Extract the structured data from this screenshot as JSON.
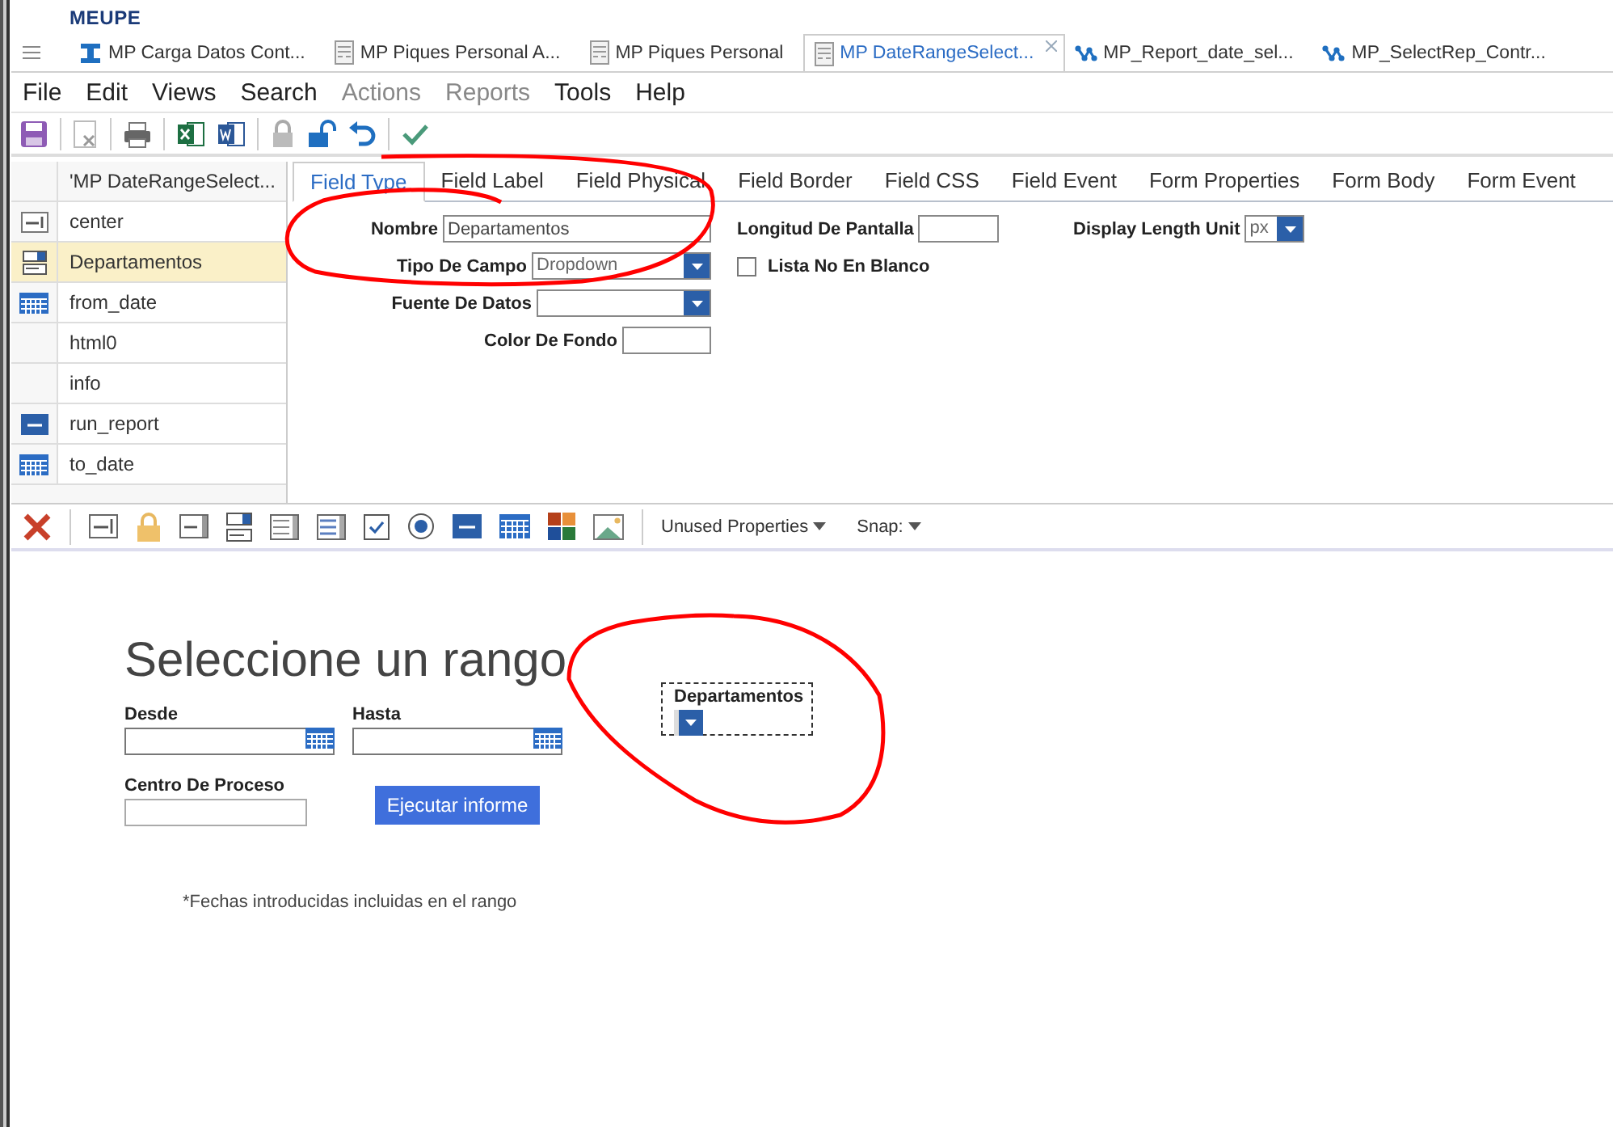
{
  "logo": {
    "text": "MEUPE"
  },
  "tabs": [
    {
      "label": "MP Carga Datos Cont...",
      "kind": "beam",
      "selected": false
    },
    {
      "label": "MP Piques Personal A...",
      "kind": "form",
      "selected": false
    },
    {
      "label": "MP Piques Personal",
      "kind": "form",
      "selected": false
    },
    {
      "label": "MP DateRangeSelect...",
      "kind": "form",
      "selected": true
    },
    {
      "label": "MP_Report_date_sel...",
      "kind": "flow",
      "selected": false
    },
    {
      "label": "MP_SelectRep_Contr...",
      "kind": "flow",
      "selected": false
    }
  ],
  "menu": [
    {
      "label": "File",
      "disabled": false
    },
    {
      "label": "Edit",
      "disabled": false
    },
    {
      "label": "Views",
      "disabled": false
    },
    {
      "label": "Search",
      "disabled": false
    },
    {
      "label": "Actions",
      "disabled": true
    },
    {
      "label": "Reports",
      "disabled": true
    },
    {
      "label": "Tools",
      "disabled": false
    },
    {
      "label": "Help",
      "disabled": false
    }
  ],
  "fields_list": {
    "header": "'MP DateRangeSelect...",
    "items": [
      {
        "name": "center",
        "kind": "text",
        "selected": false
      },
      {
        "name": "Departamentos",
        "kind": "dropdown",
        "selected": true
      },
      {
        "name": "from_date",
        "kind": "date",
        "selected": false
      },
      {
        "name": "html0",
        "kind": "html",
        "selected": false
      },
      {
        "name": "info",
        "kind": "html",
        "selected": false
      },
      {
        "name": "run_report",
        "kind": "button",
        "selected": false
      },
      {
        "name": "to_date",
        "kind": "date",
        "selected": false
      }
    ]
  },
  "property_tabs": [
    {
      "label": "Field Type",
      "selected": true
    },
    {
      "label": "Field Label",
      "selected": false
    },
    {
      "label": "Field Physical",
      "selected": false
    },
    {
      "label": "Field Border",
      "selected": false
    },
    {
      "label": "Field CSS",
      "selected": false
    },
    {
      "label": "Field Event",
      "selected": false
    },
    {
      "label": "Form Properties",
      "selected": false
    },
    {
      "label": "Form Body",
      "selected": false
    },
    {
      "label": "Form Event",
      "selected": false
    }
  ],
  "properties": {
    "nombre": {
      "label": "Nombre",
      "value": "Departamentos"
    },
    "longitud": {
      "label": "Longitud De Pantalla"
    },
    "display_length_unit": {
      "label": "Display Length Unit",
      "value": "px"
    },
    "tipo_de_campo": {
      "label": "Tipo De Campo",
      "value": "Dropdown"
    },
    "lista_no_en_blanco": {
      "label": "Lista No En Blanco",
      "checked": false
    },
    "fuente_de_datos": {
      "label": "Fuente De Datos"
    },
    "color_de_fondo": {
      "label": "Color De Fondo"
    }
  },
  "field_toolbar": {
    "unused_properties": "Unused Properties",
    "snap": "Snap:"
  },
  "canvas": {
    "title": "Seleccione un rango",
    "fields": [
      {
        "kind": "date",
        "label": "Desde"
      },
      {
        "kind": "date",
        "label": "Hasta"
      },
      {
        "kind": "text",
        "label": "Centro De Proceso"
      }
    ],
    "button": "Ejecutar informe",
    "note": "*Fechas introducidas incluidas en el rango",
    "dropdown": {
      "label": "Departamentos",
      "selected": true
    }
  }
}
